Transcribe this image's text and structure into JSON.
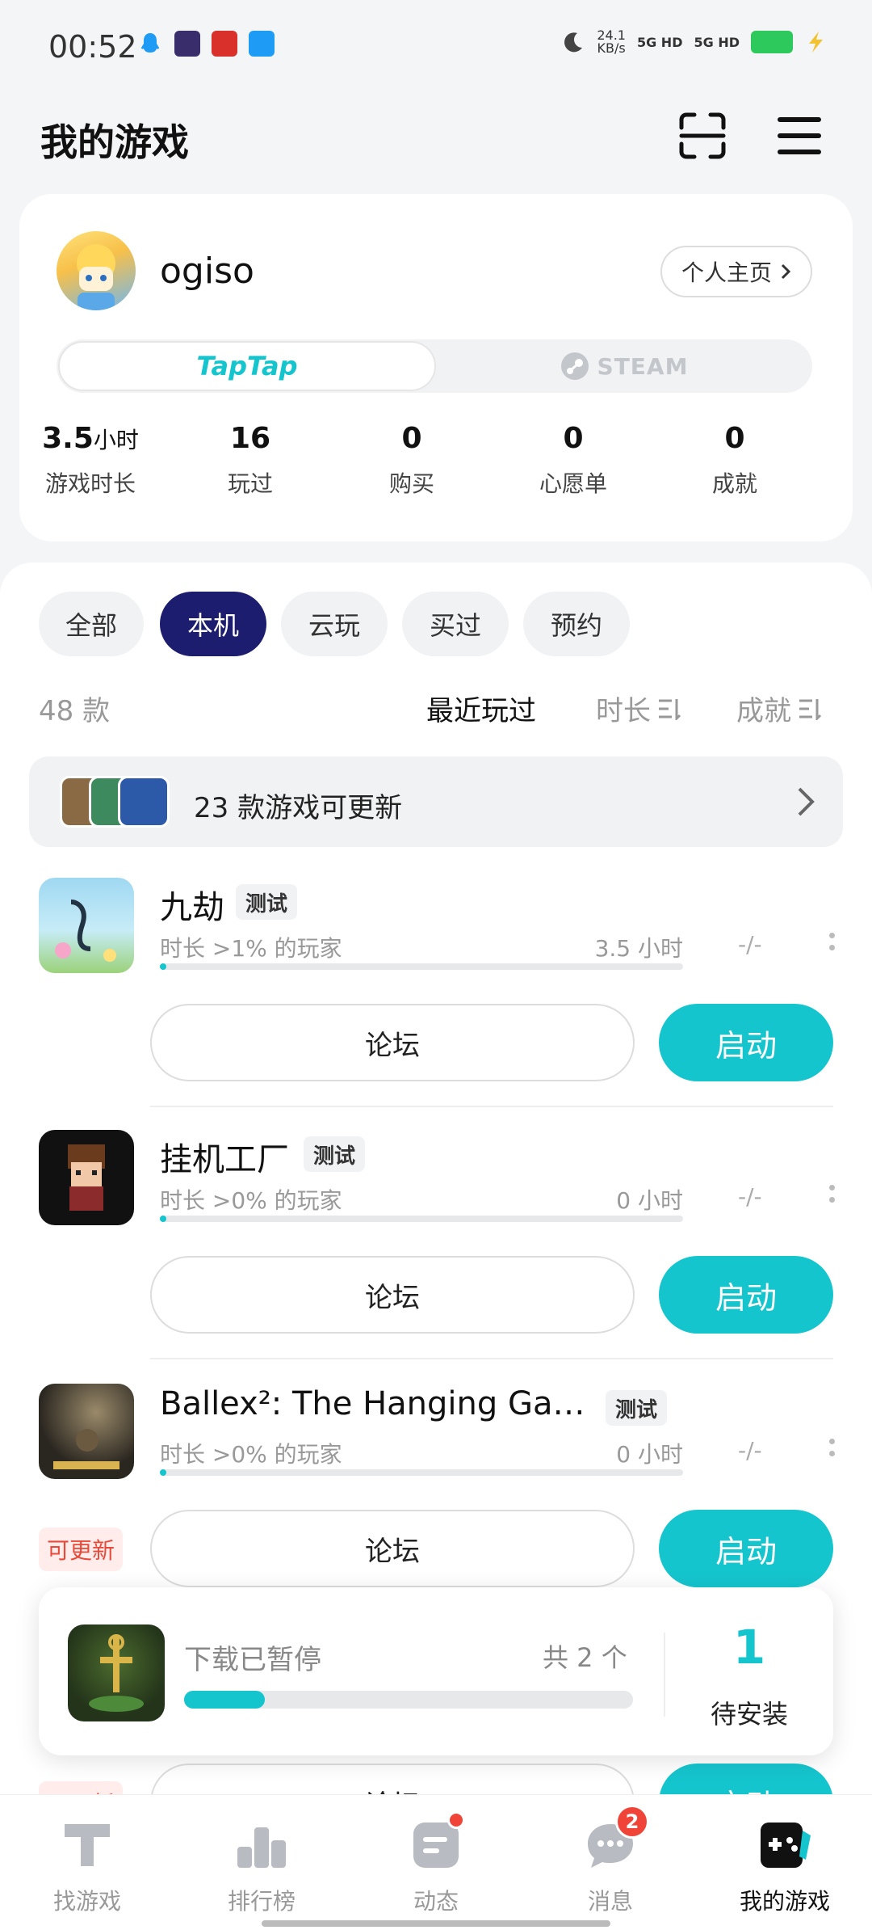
{
  "status_bar": {
    "time": "00:52",
    "net_speed_value": "24.1",
    "net_speed_unit": "KB/s",
    "sim1": "5G HD",
    "sim2": "5G HD",
    "battery_color": "#2ec95c"
  },
  "header": {
    "title": "我的游戏",
    "scan_icon": "scan-icon",
    "menu_icon": "menu-icon"
  },
  "profile": {
    "username": "ogiso",
    "home_button": "个人主页",
    "platforms": {
      "active": "TapTap",
      "inactive": "STEAM"
    },
    "stats": [
      {
        "value": "3.5",
        "unit": "小时",
        "label": "游戏时长"
      },
      {
        "value": "16",
        "unit": "",
        "label": "玩过"
      },
      {
        "value": "0",
        "unit": "",
        "label": "购买"
      },
      {
        "value": "0",
        "unit": "",
        "label": "心愿单"
      },
      {
        "value": "0",
        "unit": "",
        "label": "成就"
      }
    ]
  },
  "filters": {
    "tabs": [
      "全部",
      "本机",
      "云玩",
      "买过",
      "预约"
    ],
    "selected": "本机"
  },
  "list": {
    "count": "48 款",
    "sorts": [
      "最近玩过",
      "时长",
      "成就"
    ],
    "selected_sort": "最近玩过"
  },
  "update_banner": {
    "text": "23 款游戏可更新"
  },
  "games": [
    {
      "name": "九劫",
      "badge": "测试",
      "percentile": "时长 >1% 的玩家",
      "hours": "3.5 小时",
      "extra": "-/-",
      "progress": 0.01,
      "forum": "论坛",
      "launch": "启动",
      "update_tag": ""
    },
    {
      "name": "挂机工厂",
      "badge": "测试",
      "percentile": "时长 >0% 的玩家",
      "hours": "0 小时",
      "extra": "-/-",
      "progress": 0.0,
      "forum": "论坛",
      "launch": "启动",
      "update_tag": ""
    },
    {
      "name": "Ballex²: The Hanging Ga…",
      "badge": "测试",
      "percentile": "时长 >0% 的玩家",
      "hours": "0 小时",
      "extra": "-/-",
      "progress": 0.0,
      "forum": "论坛",
      "launch": "启动",
      "update_tag": "可更新"
    },
    {
      "forum": "论坛",
      "launch": "启动",
      "update_tag": "可更新"
    }
  ],
  "download": {
    "status": "下载已暂停",
    "total": "共 2 个",
    "progress": 0.18,
    "pending_count": "1",
    "pending_label": "待安装"
  },
  "bottom_nav": [
    {
      "label": "找游戏",
      "icon": "find-games-icon"
    },
    {
      "label": "排行榜",
      "icon": "leaderboard-icon"
    },
    {
      "label": "动态",
      "icon": "feed-icon"
    },
    {
      "label": "消息",
      "icon": "messages-icon",
      "badge": "2"
    },
    {
      "label": "我的游戏",
      "icon": "my-games-icon"
    }
  ],
  "colors": {
    "accent": "#15c5ce",
    "tab_active": "#1c1d6e",
    "badge_red": "#f04438"
  }
}
